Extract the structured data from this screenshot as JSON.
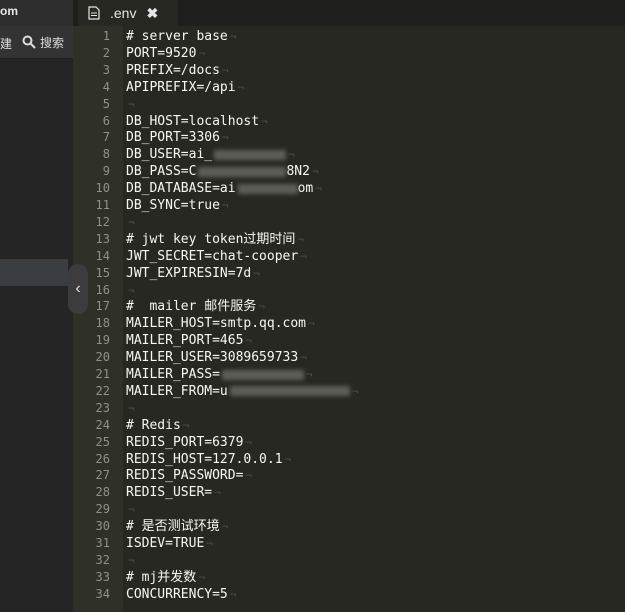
{
  "sidebar": {
    "top_text": "om",
    "toolbar_left_text": "建",
    "search_label": "搜索"
  },
  "tab": {
    "filename": ".env",
    "close_glyph": "✖"
  },
  "editor": {
    "collapse_glyph": "‹",
    "eol_glyph": "¬",
    "lines": [
      {
        "n": "1",
        "text": "# server base",
        "redacted": 0
      },
      {
        "n": "2",
        "text": "PORT=9520",
        "redacted": 0
      },
      {
        "n": "3",
        "text": "PREFIX=/docs",
        "redacted": 0
      },
      {
        "n": "4",
        "text": "APIPREFIX=/api",
        "redacted": 0
      },
      {
        "n": "5",
        "text": "",
        "redacted": 0
      },
      {
        "n": "6",
        "text": "DB_HOST=localhost",
        "redacted": 0
      },
      {
        "n": "7",
        "text": "DB_PORT=3306",
        "redacted": 0
      },
      {
        "n": "8",
        "text": "DB_USER=ai_",
        "redacted": 72
      },
      {
        "n": "9",
        "text": "DB_PASS=C",
        "redacted": 88,
        "suffix": "8N2"
      },
      {
        "n": "10",
        "text": "DB_DATABASE=ai",
        "redacted": 60,
        "suffix": "om"
      },
      {
        "n": "11",
        "text": "DB_SYNC=true",
        "redacted": 0
      },
      {
        "n": "12",
        "text": "",
        "redacted": 0
      },
      {
        "n": "13",
        "text": "# jwt key token过期时间",
        "redacted": 0
      },
      {
        "n": "14",
        "text": "JWT_SECRET=chat-cooper",
        "redacted": 0
      },
      {
        "n": "15",
        "text": "JWT_EXPIRESIN=7d",
        "redacted": 0
      },
      {
        "n": "16",
        "text": "",
        "redacted": 0
      },
      {
        "n": "17",
        "text": "#  mailer 邮件服务",
        "redacted": 0
      },
      {
        "n": "18",
        "text": "MAILER_HOST=smtp.qq.com",
        "redacted": 0
      },
      {
        "n": "19",
        "text": "MAILER_PORT=465",
        "redacted": 0
      },
      {
        "n": "20",
        "text": "MAILER_USER=3089659733",
        "redacted": 0
      },
      {
        "n": "21",
        "text": "MAILER_PASS=",
        "redacted": 82
      },
      {
        "n": "22",
        "text": "MAILER_FROM=u",
        "redacted": 120
      },
      {
        "n": "23",
        "text": "",
        "redacted": 0
      },
      {
        "n": "24",
        "text": "# Redis",
        "redacted": 0
      },
      {
        "n": "25",
        "text": "REDIS_PORT=6379",
        "redacted": 0
      },
      {
        "n": "26",
        "text": "REDIS_HOST=127.0.0.1",
        "redacted": 0
      },
      {
        "n": "27",
        "text": "REDIS_PASSWORD=",
        "redacted": 0
      },
      {
        "n": "28",
        "text": "REDIS_USER=",
        "redacted": 0
      },
      {
        "n": "29",
        "text": "",
        "redacted": 0
      },
      {
        "n": "30",
        "text": "# 是否测试环境",
        "redacted": 0
      },
      {
        "n": "31",
        "text": "ISDEV=TRUE",
        "redacted": 0
      },
      {
        "n": "32",
        "text": "",
        "redacted": 0
      },
      {
        "n": "33",
        "text": "# mj并发数",
        "redacted": 0
      },
      {
        "n": "34",
        "text": "CONCURRENCY=5",
        "redacted": 0
      }
    ]
  }
}
